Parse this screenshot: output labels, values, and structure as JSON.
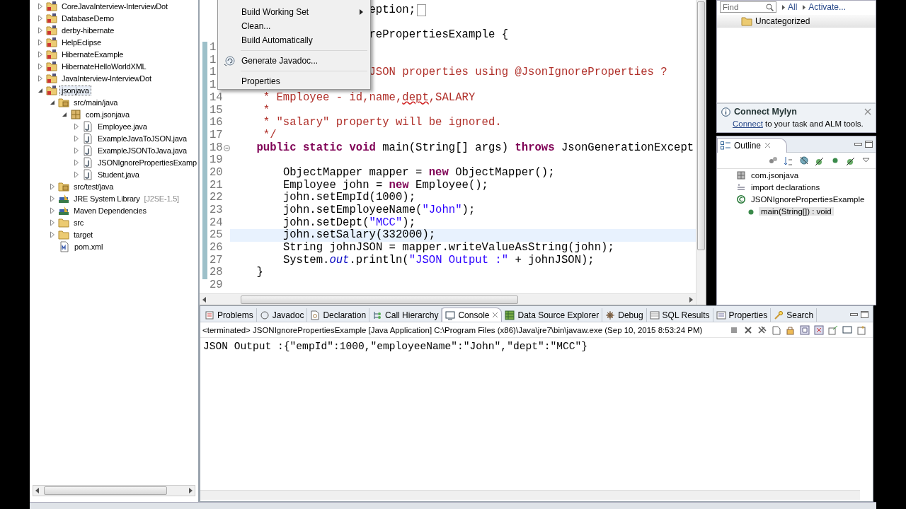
{
  "explorer": {
    "items": [
      {
        "kind": "project",
        "label": "CoreJavaInterview-InterviewDot",
        "expanded": false,
        "selected": false
      },
      {
        "kind": "project",
        "label": "DatabaseDemo",
        "expanded": false,
        "selected": false
      },
      {
        "kind": "project",
        "label": "derby-hibernate",
        "expanded": false,
        "selected": false
      },
      {
        "kind": "project",
        "label": "HelpEclipse",
        "expanded": false,
        "selected": false
      },
      {
        "kind": "project",
        "label": "HibernateExample",
        "expanded": false,
        "selected": false
      },
      {
        "kind": "project",
        "label": "HibernateHelloWorldXML",
        "expanded": false,
        "selected": false
      },
      {
        "kind": "project",
        "label": "JavaInterview-InterviewDot",
        "expanded": false,
        "selected": false
      },
      {
        "kind": "project",
        "label": "jsonjava",
        "expanded": true,
        "selected": true,
        "children": [
          {
            "kind": "source-folder",
            "label": "src/main/java",
            "expanded": true,
            "selected": false,
            "children": [
              {
                "kind": "package",
                "label": "com.jsonjava",
                "expanded": true,
                "selected": false,
                "children": [
                  {
                    "kind": "java-file",
                    "label": "Employee.java",
                    "expanded": false,
                    "selected": false
                  },
                  {
                    "kind": "java-file",
                    "label": "ExampleJavaToJSON.java",
                    "expanded": false,
                    "selected": false
                  },
                  {
                    "kind": "java-file",
                    "label": "ExampleJSONToJava.java",
                    "expanded": false,
                    "selected": false
                  },
                  {
                    "kind": "java-file",
                    "label": "JSONIgnorePropertiesExamp",
                    "expanded": false,
                    "selected": false
                  },
                  {
                    "kind": "java-file",
                    "label": "Student.java",
                    "expanded": false,
                    "selected": false
                  }
                ]
              }
            ]
          },
          {
            "kind": "source-folder",
            "label": "src/test/java",
            "expanded": false,
            "selected": false
          },
          {
            "kind": "library",
            "label": "JRE System Library",
            "decoration": "[J2SE-1.5]",
            "expanded": false,
            "selected": false
          },
          {
            "kind": "library",
            "label": "Maven Dependencies",
            "expanded": false,
            "selected": false
          },
          {
            "kind": "folder",
            "label": "src",
            "expanded": false,
            "selected": false
          },
          {
            "kind": "folder",
            "label": "target",
            "expanded": false,
            "selected": false
          },
          {
            "kind": "xml-file",
            "label": "pom.xml",
            "selected": false
          }
        ]
      }
    ]
  },
  "editor": {
    "lines": [
      {
        "folded": true,
        "segments": [
          {
            "kind": "plain",
            "text": "                     eption;"
          }
        ]
      },
      {
        "blank_before": true,
        "segments": [
          {
            "kind": "plain",
            "text": "                     rePropertiesExample {"
          }
        ]
      },
      {
        "number": "1"
      },
      {
        "number": "1"
      },
      {
        "number": "1",
        "segments": [
          {
            "kind": "comment",
            "text": "                     JSON properties using @JsonIgnoreProperties ?"
          }
        ]
      },
      {
        "number": "1"
      },
      {
        "number": "14",
        "segments": [
          {
            "kind": "comment",
            "text": "     * Employee - id,name,"
          },
          {
            "kind": "misspelled",
            "text": "dept"
          },
          {
            "kind": "comment",
            "text": ",SALARY"
          }
        ]
      },
      {
        "number": "15",
        "segments": [
          {
            "kind": "comment",
            "text": "     *"
          }
        ]
      },
      {
        "number": "16",
        "segments": [
          {
            "kind": "comment",
            "text": "     * \"salary\" property will be ignored."
          }
        ]
      },
      {
        "number": "17",
        "segments": [
          {
            "kind": "comment",
            "text": "     */"
          }
        ]
      },
      {
        "number": "18",
        "foldable": true,
        "segments": [
          {
            "kind": "keyword",
            "text": "    public"
          },
          {
            "kind": "keyword",
            "text": " static"
          },
          {
            "kind": "keyword",
            "text": " void"
          },
          {
            "kind": "plain",
            "text": " main(String[] args) "
          },
          {
            "kind": "keyword",
            "text": "throws"
          },
          {
            "kind": "plain",
            "text": " JsonGenerationExcept"
          }
        ]
      },
      {
        "number": "19"
      },
      {
        "number": "20",
        "segments": [
          {
            "kind": "plain",
            "text": "        ObjectMapper mapper = "
          },
          {
            "kind": "keyword",
            "text": "new"
          },
          {
            "kind": "plain",
            "text": " ObjectMapper();"
          }
        ]
      },
      {
        "number": "21",
        "segments": [
          {
            "kind": "plain",
            "text": "        Employee john = "
          },
          {
            "kind": "keyword",
            "text": "new"
          },
          {
            "kind": "plain",
            "text": " Employee();"
          }
        ]
      },
      {
        "number": "22",
        "segments": [
          {
            "kind": "plain",
            "text": "        john.setEmpId(1000);"
          }
        ]
      },
      {
        "number": "23",
        "segments": [
          {
            "kind": "plain",
            "text": "        john.setEmployeeName("
          },
          {
            "kind": "string",
            "text": "\"John\""
          },
          {
            "kind": "plain",
            "text": ");"
          }
        ]
      },
      {
        "number": "24",
        "segments": [
          {
            "kind": "plain",
            "text": "        john.setDept("
          },
          {
            "kind": "string",
            "text": "\"MCC\""
          },
          {
            "kind": "plain",
            "text": ");"
          }
        ]
      },
      {
        "number": "25",
        "current": true,
        "segments": [
          {
            "kind": "plain",
            "text": "        john.setSalary(332000);"
          }
        ]
      },
      {
        "number": "26",
        "segments": [
          {
            "kind": "plain",
            "text": "        String johnJSON = mapper.writeValueAsString(john);"
          }
        ]
      },
      {
        "number": "27",
        "segments": [
          {
            "kind": "plain",
            "text": "        System."
          },
          {
            "kind": "field",
            "text": "out"
          },
          {
            "kind": "plain",
            "text": ".println("
          },
          {
            "kind": "string",
            "text": "\"JSON Output :\""
          },
          {
            "kind": "plain",
            "text": " + johnJSON);"
          }
        ]
      },
      {
        "number": "28",
        "segments": [
          {
            "kind": "plain",
            "text": "    }"
          }
        ]
      },
      {
        "number": "29"
      }
    ],
    "context_menu": {
      "items": [
        {
          "kind": "submenu",
          "label": "Build Working Set"
        },
        {
          "kind": "item",
          "label": "Clean..."
        },
        {
          "kind": "item",
          "label": "Build Automatically"
        },
        {
          "kind": "separator"
        },
        {
          "kind": "icon-item",
          "label": "Generate Javadoc..."
        },
        {
          "kind": "separator"
        },
        {
          "kind": "item",
          "label": "Properties"
        }
      ]
    }
  },
  "task_list": {
    "find": {
      "placeholder": "Find"
    },
    "links": [
      "All",
      "Activate..."
    ],
    "categories": [
      "Uncategorized"
    ]
  },
  "mylyn": {
    "title": "Connect Mylyn",
    "link": "Connect",
    "text": " to your task and ALM tools."
  },
  "outline": {
    "title": "Outline",
    "items": [
      {
        "kind": "package",
        "label": "com.jsonjava",
        "selected": false
      },
      {
        "kind": "imports",
        "label": "import declarations",
        "selected": false
      },
      {
        "kind": "class",
        "label": "JSONIgnorePropertiesExample",
        "selected": false,
        "children": [
          {
            "kind": "method",
            "label": "main(String[]) : void",
            "selected": true
          }
        ]
      }
    ]
  },
  "console": {
    "tabs": [
      {
        "kind": "problems",
        "label": "Problems",
        "selected": false
      },
      {
        "kind": "javadoc",
        "label": "Javadoc",
        "selected": false
      },
      {
        "kind": "declaration",
        "label": "Declaration",
        "selected": false
      },
      {
        "kind": "hierarchy",
        "label": "Call Hierarchy",
        "selected": false
      },
      {
        "kind": "console",
        "label": "Console",
        "selected": true
      },
      {
        "kind": "datasource",
        "label": "Data Source Explorer",
        "selected": false
      },
      {
        "kind": "debug",
        "label": "Debug",
        "selected": false
      },
      {
        "kind": "sql",
        "label": "SQL Results",
        "selected": false
      },
      {
        "kind": "properties",
        "label": "Properties",
        "selected": false
      },
      {
        "kind": "search",
        "label": "Search",
        "selected": false
      }
    ],
    "status": "<terminated> JSONIgnorePropertiesExample [Java Application] C:\\Program Files (x86)\\Java\\jre7\\bin\\javaw.exe (Sep 10, 2015 8:53:24 PM)",
    "output": "JSON Output :{\"empId\":1000,\"employeeName\":\"John\",\"dept\":\"MCC\"}"
  }
}
